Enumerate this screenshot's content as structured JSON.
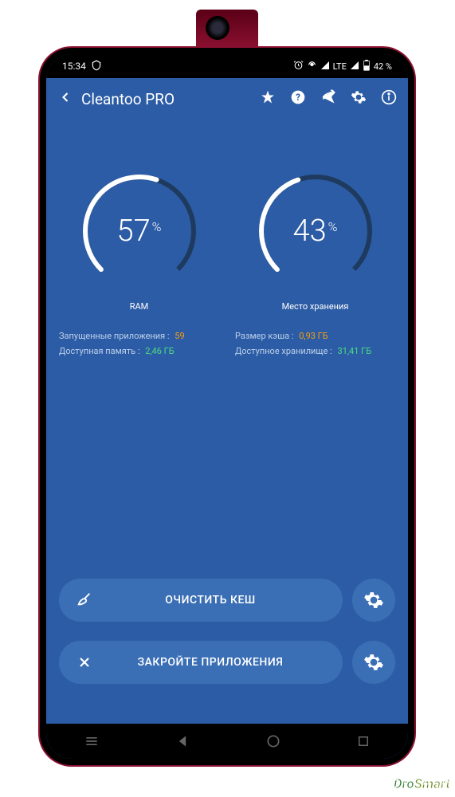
{
  "status": {
    "time": "15:34",
    "network": "LTE",
    "battery": "42 %"
  },
  "app": {
    "title": "Cleantoo PRO"
  },
  "gauges": {
    "ram": {
      "value": "57",
      "pct": "%",
      "label": "RAM"
    },
    "storage": {
      "value": "43",
      "pct": "%",
      "label": "Место хранения"
    }
  },
  "stats": {
    "left": {
      "row1": {
        "label": "Запущенные приложения :",
        "value": "59"
      },
      "row2": {
        "label": "Доступная память :",
        "value": "2,46 ГБ"
      }
    },
    "right": {
      "row1": {
        "label": "Размер кэша :",
        "value": "0,93 ГБ"
      },
      "row2": {
        "label": "Доступное хранилище :",
        "value": "31,41 ГБ"
      }
    }
  },
  "actions": {
    "clear_cache": "ОЧИСТИТЬ КЕШ",
    "close_apps": "ЗАКРОЙТЕ ПРИЛОЖЕНИЯ"
  },
  "watermark": {
    "a": "Dro",
    "b": "Smart"
  }
}
